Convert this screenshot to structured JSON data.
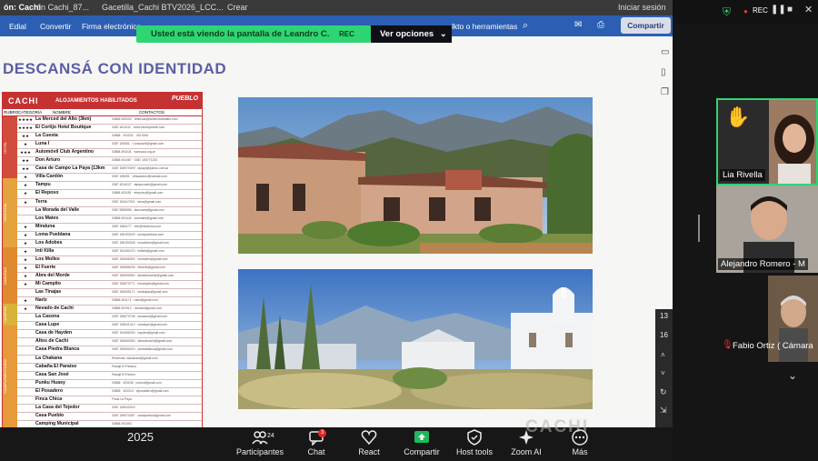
{
  "chrome_bar": {
    "left_label": "ón: Cachi",
    "tab1": "ón Cachi_87...",
    "tab2": "Gacetilla_Cachi BTV2026_LCC...",
    "tab3": "Crear",
    "right_label": "Iniciar sesión"
  },
  "menu_bar": {
    "items": [
      "Edial",
      "Convertir",
      "Firma electrónica",
      "...",
      "lkto o herramientas"
    ],
    "share_label": "Compartir"
  },
  "share_banner": {
    "text": "Usted está viendo la pantalla de  Leandro C.",
    "rec": "REC",
    "options": "Ver opciones"
  },
  "window_controls": {
    "rec": "REC"
  },
  "slide": {
    "title": "DESCANSÁ CON IDENTIDAD",
    "year": "2025",
    "watermark": "CACHI"
  },
  "table": {
    "brand": "CACHI",
    "subtitle": "ALOJAMIENTOS HABILITADOS",
    "pueblo": "PUEBLO",
    "col_headers": [
      "RUBRO",
      "CATEGORÍA",
      "NOMBRE",
      "CONTACTOS"
    ],
    "sections": [
      "HOTEL",
      "HOSTERÍA",
      "CABAÑAS",
      "CAMPING",
      "COMPLEMENTARIO"
    ],
    "rows": [
      {
        "stars": "★★★★",
        "name": "La Merced del Alto (3km)",
        "contact": "03868 490020 · reservas@lamerceddelalto.com"
      },
      {
        "stars": "★★★★",
        "name": "El Cortijo Hotel Boutique",
        "contact": "0387-4611111 · www.elcortijohotel.com"
      },
      {
        "stars": "★★",
        "name": "La Cuesta",
        "contact": "03868 · 491031 · 4917655"
      },
      {
        "stars": "★",
        "name": "Luna I",
        "contact": "0387 155051 · Lunacachi@gmail.com"
      },
      {
        "stars": "★★★",
        "name": "Automóvil Club Argentino",
        "contact": "03868 491104 · www.aca.org.ar"
      },
      {
        "stars": "★★",
        "name": "Don Arturo",
        "contact": "03868 491087 · 0387 155771234"
      },
      {
        "stars": "★★",
        "name": "Casa de Campo La Paya (13km.)",
        "contact": "0387 155970009 · lapaya@yahoo.com.ar"
      },
      {
        "stars": "★",
        "name": "Villa Cardón",
        "contact": "0387 155051 · villacardon@hotmail.com"
      },
      {
        "stars": "★",
        "name": "Tampu",
        "contact": "0387 4914127 · tampucachi@gmail.com"
      },
      {
        "stars": "★",
        "name": "El Reposo",
        "contact": "03868 491181 · elreposo@gmail.com"
      },
      {
        "stars": "★",
        "name": "Terra",
        "contact": "0387 154417001 · terra@gmail.com"
      },
      {
        "stars": "",
        "name": "La Morada del Valle",
        "contact": "0387 5555555 · lamorada@gmail.com"
      },
      {
        "stars": "",
        "name": "Los Mates",
        "contact": "03868 491042 · losmates@gmail.com"
      },
      {
        "stars": "★",
        "name": "Miraluna",
        "contact": "0387 1564177 · info@miraluna.com"
      },
      {
        "stars": "★",
        "name": "Loma Pueblana",
        "contact": "0387 155193200 · lomapueblana.com"
      },
      {
        "stars": "★",
        "name": "Los Adobes",
        "contact": "0387 155192008 · losadobes@gmail.com"
      },
      {
        "stars": "★",
        "name": "Inti Killa",
        "contact": "0387 154152470 · intikilla@gmail.com"
      },
      {
        "stars": "★",
        "name": "Los Molles",
        "contact": "0387 155056300 · losmolles@gmail.com"
      },
      {
        "stars": "★",
        "name": "El Fuerte",
        "contact": "0387 155088236 · elfuerte@gmail.com"
      },
      {
        "stars": "★",
        "name": "Abra del Morde",
        "contact": "0387 155090552 · abradelmorde@gmail.com"
      },
      {
        "stars": "★",
        "name": "Mi Campito",
        "contact": "0387 155070771 · micampito@gmail.com"
      },
      {
        "stars": "",
        "name": "Las Tinajas",
        "contact": "0387 155055171 · lastinajas@gmail.com"
      },
      {
        "stars": "★",
        "name": "Nariz",
        "contact": "03868 491171 · nariz@gmail.com"
      },
      {
        "stars": "★",
        "name": "Nevado de Cachi",
        "contact": "03868 491912 · nevado@gmail.com"
      },
      {
        "stars": "",
        "name": "La Casona",
        "contact": "0387 155070736 · lacasona@gmail.com"
      },
      {
        "stars": "",
        "name": "Casa Lupe",
        "contact": "0387 155041312 · casalupe@gmail.com"
      },
      {
        "stars": "",
        "name": "Casa de Hayden",
        "contact": "0387 154306230 · hayden@gmail.com"
      },
      {
        "stars": "",
        "name": "Altos de Cachi",
        "contact": "0387 155050280 · altosdecachi@gmail.com"
      },
      {
        "stars": "",
        "name": "Casa Piedra Blanca",
        "contact": "0387 155050210 · piedrablanca@gmail.com"
      },
      {
        "stars": "",
        "name": "La Chakana",
        "contact": "Reservas: lachakana@gmail.com"
      },
      {
        "stars": "",
        "name": "Cabaña El Paraíso",
        "contact": "Pasaje El Paraíso"
      },
      {
        "stars": "",
        "name": "Casa San José",
        "contact": "Pasaje El Recreo"
      },
      {
        "stars": "",
        "name": "Punku Huasy",
        "contact": "03868 · 491106 · punku@gmail.com"
      },
      {
        "stars": "",
        "name": "El Posadero",
        "contact": "03868 · 491013 · elposadero@gmail.com"
      },
      {
        "stars": "",
        "name": "Finca Chica",
        "contact": "Finca La Paya"
      },
      {
        "stars": "",
        "name": "La Casa del Tejedor",
        "contact": "0387 155040015"
      },
      {
        "stars": "",
        "name": "Casa Pueblo",
        "contact": "0387 155070387 · casapueblo@gmail.com"
      },
      {
        "stars": "",
        "name": "Camping Municipal",
        "contact": "03868 491053"
      }
    ]
  },
  "participants": [
    {
      "name": "Lia Rivella",
      "hand_raised": true
    },
    {
      "name": "Alejandro Romero - M"
    },
    {
      "name": "Fabio Ortiz ( Cámara",
      "muted": true
    }
  ],
  "page_counter": {
    "a": "13",
    "b": "16"
  },
  "toolbar": {
    "participants_label": "Participantes",
    "participants_count": "24",
    "chat_label": "Chat",
    "chat_badge": "3",
    "react_label": "React",
    "share_label": "Compartir",
    "host_tools_label": "Host tools",
    "zoom_ai_label": "Zoom AI",
    "more_label": "Más"
  },
  "colors": {
    "brand_red": "#c63232",
    "banner_green": "#2ed573",
    "title_purple": "#5c5ea5"
  }
}
